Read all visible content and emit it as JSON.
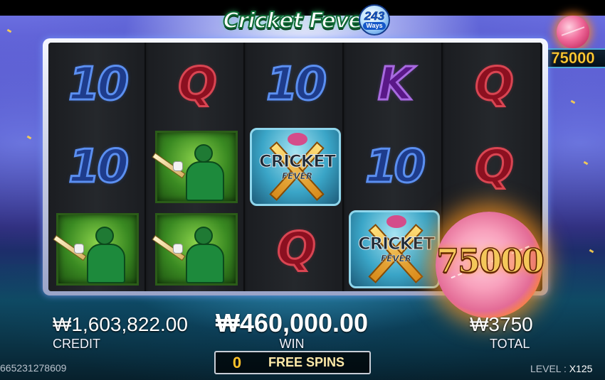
{
  "game": {
    "logo_text": "Cricket Fever",
    "ways_number": "243",
    "ways_word": "Ways"
  },
  "jackpot": {
    "value": "75000"
  },
  "reels": [
    [
      "10",
      "10",
      "player"
    ],
    [
      "Q",
      "player",
      "player"
    ],
    [
      "10",
      "scatter",
      "Q"
    ],
    [
      "K",
      "10",
      "scatter"
    ],
    [
      "Q",
      "Q",
      "fireball"
    ]
  ],
  "scatter": {
    "line1": "CRICKET",
    "line2": "FEVER"
  },
  "fireball": {
    "value": "75000"
  },
  "credit": {
    "value": "₩1,603,822.00",
    "label": "CREDIT"
  },
  "win": {
    "value": "₩460,000.00",
    "label": "WIN"
  },
  "total": {
    "value": "₩3750",
    "label": "TOTAL"
  },
  "free_spins": {
    "count": "0",
    "label": "FREE SPINS"
  },
  "round_id": "665231278609",
  "level": {
    "label": "LEVEL : ",
    "value": "X125"
  },
  "colors": {
    "ten": "#5b8ff0",
    "queen": "#d94552",
    "king": "#a86ae0",
    "gold": "#ffd23b"
  }
}
